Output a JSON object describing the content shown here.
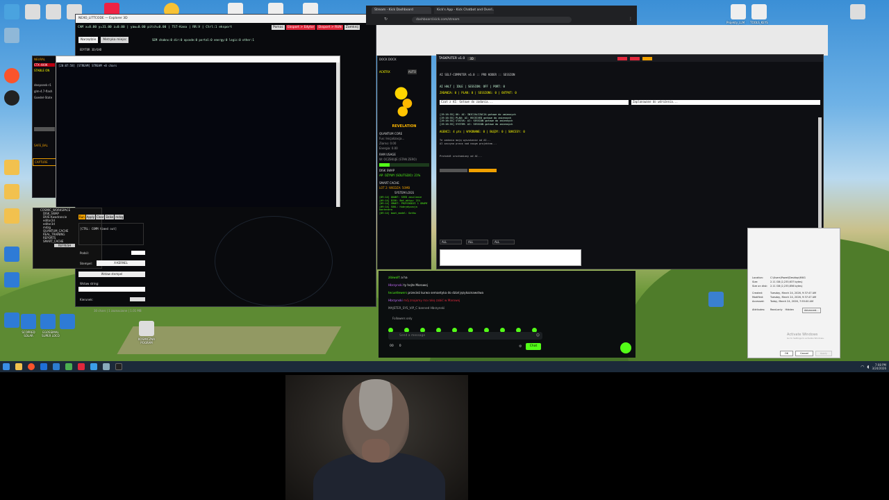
{
  "desktop": {
    "icons_left": [
      "This PC",
      "Recycle Bin",
      "Brave",
      "Dokumenty",
      "Obrazy",
      "Muzyka",
      "Wideo",
      "Pobrane"
    ],
    "icons_bottom": [
      "SCOPRED SOLAR",
      "EGOSSIMAL SUPER LOCO",
      "KOSMICZNA POGRAM"
    ],
    "icons_right": [
      "Projekty_LLM",
      "TOOLS_KEYS"
    ]
  },
  "editor": {
    "title": "NEXO_LITTCODE — Explorer 3D",
    "status_line": "CAM x=0.00 y=31.00 z=0.00 | yaw=0.00 pitch=0.00 | TST-Kana | RR:V | Ctrl:1 eksport",
    "buttons": [
      "Pomoc",
      "Eksport > Edytor",
      "Eksport > RUN",
      "Zamknij"
    ],
    "tabs": [
      "Narzędzie",
      "Metryka miejsc"
    ],
    "section_label": "EDYTOR 3D/6AD",
    "sem_line": "SEM  chaknx:0  dir:0  opcode:0  portal:0  energy:0  logic:0  other:1",
    "console_line": "[20:07:58] [STREAM] STREAM +0 chars",
    "tree": [
      "COSMIC_WORKSPACE",
      "DISK_SWAP",
      "DIVE-Kwadrancie",
      "editor2d",
      "editor3d",
      "mdzg",
      "QUANTUM_CACHE",
      "REAL_TRAINING",
      "REPORTS",
      "SMART_CACHE"
    ],
    "tree_button": "REFRESH",
    "run_buttons": [
      "Run",
      "Apply",
      "Clear",
      "Dzike",
      "mdzg"
    ],
    "output": "[CTRL: COMM timed out]",
    "labels": {
      "podsil": "Podsil:",
      "stempel": "Stempel:",
      "insert": "Wstaw stempel",
      "string": "Wstaw string:",
      "kierunek": "Kierunek:"
    },
    "stempel_value": "X-KERNEL",
    "footer": "30 chars | 1 zaznaczone | 1.01 MB"
  },
  "side_panel": {
    "items": [
      "NEURAL",
      "CTX 400K",
      "STABLE ON",
      "deepseek-r1",
      "glm-4.7-flash",
      "Goedel-State",
      "SAFE_BAL",
      "CAPTURE"
    ]
  },
  "browser": {
    "tabs": [
      "Stream - Kick Dashboard",
      "Kick's App - Kick Chatbot and Overl..."
    ],
    "url": "dashboard.kick.com/stream"
  },
  "dock": {
    "header": "DOCK  DOCK",
    "tag": "ACKTRX",
    "auto": "AUTO",
    "revelation": "REVELATION",
    "lines": [
      "QUANTUM CORE",
      "Fus: Inicjalizacja...",
      "Ziarno: 0.00",
      "Energia: 0.00",
      "RAM USAGE",
      "W: OCZEKUJE (STAN ZERO)",
      "DISK SWAP",
      "AP: OŻYWY (SOLITGDO): 21%",
      "SMART CACHE",
      "LOT 2: WIEDZA: 50MB",
      "SYSTEM LOGS"
    ],
    "logs": [
      "[09:14] QUANT: SEED zasilanie",
      "[09:14] DISK: Bot_aktyw: 21%",
      "[09:14] SMART: PRZYCHODZI 1 GRAMY",
      "[09:14] SOUL: Hubrydyzacja kontenera",
      "[09:14] boot_model: Gotów"
    ]
  },
  "taskputer": {
    "title": "TASKPUTER v1.0",
    "mode": "3D",
    "subtitle": "AI SELF-COMPUTER v6.0 :: PRO KODER :: SESSION",
    "status": "AI HALT | IDLE | SESSION: OFF | PORT: 0",
    "section_tokens": "ZADANIA: 0 | PLAN: 0 | SESSIONS: 0 | OUTPUT: 0",
    "chat_left": "Czat z AI: Gotowe do zadania...",
    "chat_right": "Zaplanowane do wdrożenia...",
    "log_lines": [
      "[19:16:55] OK: AI: INICJALIZACJA gotowe do zmiennych",
      "[19:16:55] PLAN: AI: RECEIVED gotowe do zmiennych",
      "[19:16:55] STATUS: AI: SESSION gotowe do zmiennych",
      "[19:16:55] SYSTEM: AI: SESSION gotowe do zmiennych"
    ],
    "agents_line": "AGENCI: 4 pts | WYKONANE: 0 | BŁĘDY: 0 | SUKCESY: 0",
    "hint1": "Te zadania mają wyszukanie od AI...",
    "hint2": "AI zaczyna pracę nad nowym projektem...",
    "footer_line": "Protokół uruchomiony od AI...",
    "filters": [
      "ALL",
      "ALL",
      "ALL"
    ]
  },
  "kick": {
    "messages": [
      {
        "user": "zibiwolf",
        "text": ": a ha"
      },
      {
        "user": "Hbrzynski",
        "text": "ty hejte Morowej"
      },
      {
        "user": "tecuetlewers",
        "text": "przecież kurwa semantyka do dział językoznawstwa"
      },
      {
        "user": "Hbrzynski",
        "text": "mój znajomy ma rakę zabić w Marowej"
      },
      {
        "user": "MAJSTER_SYS_VIP_C",
        "text": "banned Hbrzynski"
      }
    ],
    "followers_only": "Followers only",
    "placeholder": "Send a message",
    "count1": "00",
    "count2": "0",
    "chat_button": "Chat"
  },
  "file_props": {
    "fields": [
      {
        "label": "Location:",
        "value": "C:\\Users\\Pawel\\Desktop\\MXG"
      },
      {
        "label": "Size:",
        "value": "2.11 GB (2,233,637 bytes)"
      },
      {
        "label": "Size on disk:",
        "value": "2.11 GB (2,233,856 bytes)"
      },
      {
        "label": "Created:",
        "value": "Tuesday, March 24, 2026, 9:37:47 AM"
      },
      {
        "label": "Modified:",
        "value": "Tuesday, March 24, 2026, 9:37:47 AM"
      },
      {
        "label": "Accessed:",
        "value": "Today, March 24, 2026, 7:55:00 AM"
      }
    ],
    "attributes_label": "Attributes:",
    "readonly": "Read-only",
    "hidden": "Hidden",
    "advanced": "Advanced...",
    "activate1": "Activate Windows",
    "activate2": "Go to Settings to activate Windows.",
    "buttons": [
      "OK",
      "Cancel",
      "Apply"
    ]
  },
  "taskbar": {
    "time": "7:08 PM",
    "date": "3/24/2026"
  },
  "colors": {
    "kick_green": "#53fc18",
    "accent_red": "#e0283c",
    "accent_orange": "#f0a000",
    "dark_bg": "#0b0c10"
  }
}
